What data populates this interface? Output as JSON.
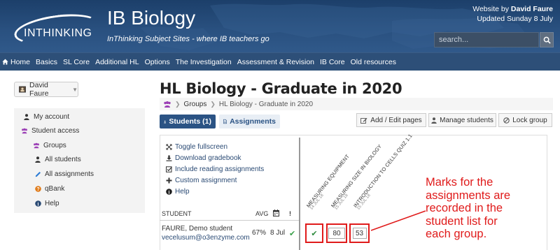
{
  "header": {
    "logo_text": "INTHINKING",
    "site_title": "IB Biology",
    "tagline_brand": "InThinking",
    "tagline_rest": "Subject Sites - where IB teachers go",
    "meta_prefix": "Website by",
    "meta_author": "David Faure",
    "meta_updated": "Updated Sunday 8 July",
    "search_placeholder": "search..."
  },
  "nav": [
    {
      "label": "Home",
      "icon": "home-icon"
    },
    {
      "label": "Basics"
    },
    {
      "label": "SL Core"
    },
    {
      "label": "Additional HL"
    },
    {
      "label": "Options"
    },
    {
      "label": "The Investigation"
    },
    {
      "label": "Assessment & Revision"
    },
    {
      "label": "IB Core"
    },
    {
      "label": "Old resources"
    }
  ],
  "user_menu": {
    "name": "David Faure"
  },
  "sidebar": {
    "items": [
      {
        "label": "My account",
        "icon": "user-icon",
        "color": "#333333"
      },
      {
        "label": "Student access",
        "icon": "users-icon",
        "color": "#9b3fb5"
      },
      {
        "label": "Groups",
        "icon": "users-icon",
        "color": "#9b3fb5"
      },
      {
        "label": "All students",
        "icon": "user-icon",
        "color": "#333333"
      },
      {
        "label": "All assignments",
        "icon": "pencil-icon",
        "color": "#2c7bd4"
      },
      {
        "label": "qBank",
        "icon": "question-icon",
        "color": "#e07b1a"
      },
      {
        "label": "Help",
        "icon": "info-icon",
        "color": "#2a4a74"
      }
    ]
  },
  "page": {
    "title": "HL Biology - Graduate in 2020",
    "breadcrumb": {
      "groups": "Groups",
      "current": "HL Biology - Graduate in 2020"
    },
    "tabs": {
      "students": "Students (1)",
      "assignments": "Assignments"
    },
    "actions": {
      "add_edit": "Add / Edit pages",
      "manage": "Manage students",
      "lock": "Lock group"
    }
  },
  "gradebook": {
    "tools": [
      "Toggle fullscreen",
      "Download gradebook",
      "Include reading assignments",
      "Custom assignment",
      "Help"
    ],
    "headers": {
      "student": "STUDENT",
      "avg": "AVG",
      "excl": "!"
    },
    "columns": [
      {
        "title": "MEASURING EQUIPMENT",
        "date": "14 JUL 18"
      },
      {
        "title": "MEASURING SIZE IN BIOLOGY",
        "date": "15 JUL 18"
      },
      {
        "title": "INTRODUCTION TO CELLS QUIZ 1.1",
        "date": "15 JUL 18"
      }
    ],
    "student": {
      "name": "FAURE, Demo student",
      "email": "vecelusum@o3enzyme.com",
      "avg": "67%",
      "date": "8 Jul",
      "marks": [
        "80",
        "53"
      ]
    }
  },
  "annotation": {
    "lines": [
      "Marks for the",
      "assignments are",
      "recorded in the",
      "student list for",
      "each group."
    ],
    "color": "#e01b1b"
  }
}
